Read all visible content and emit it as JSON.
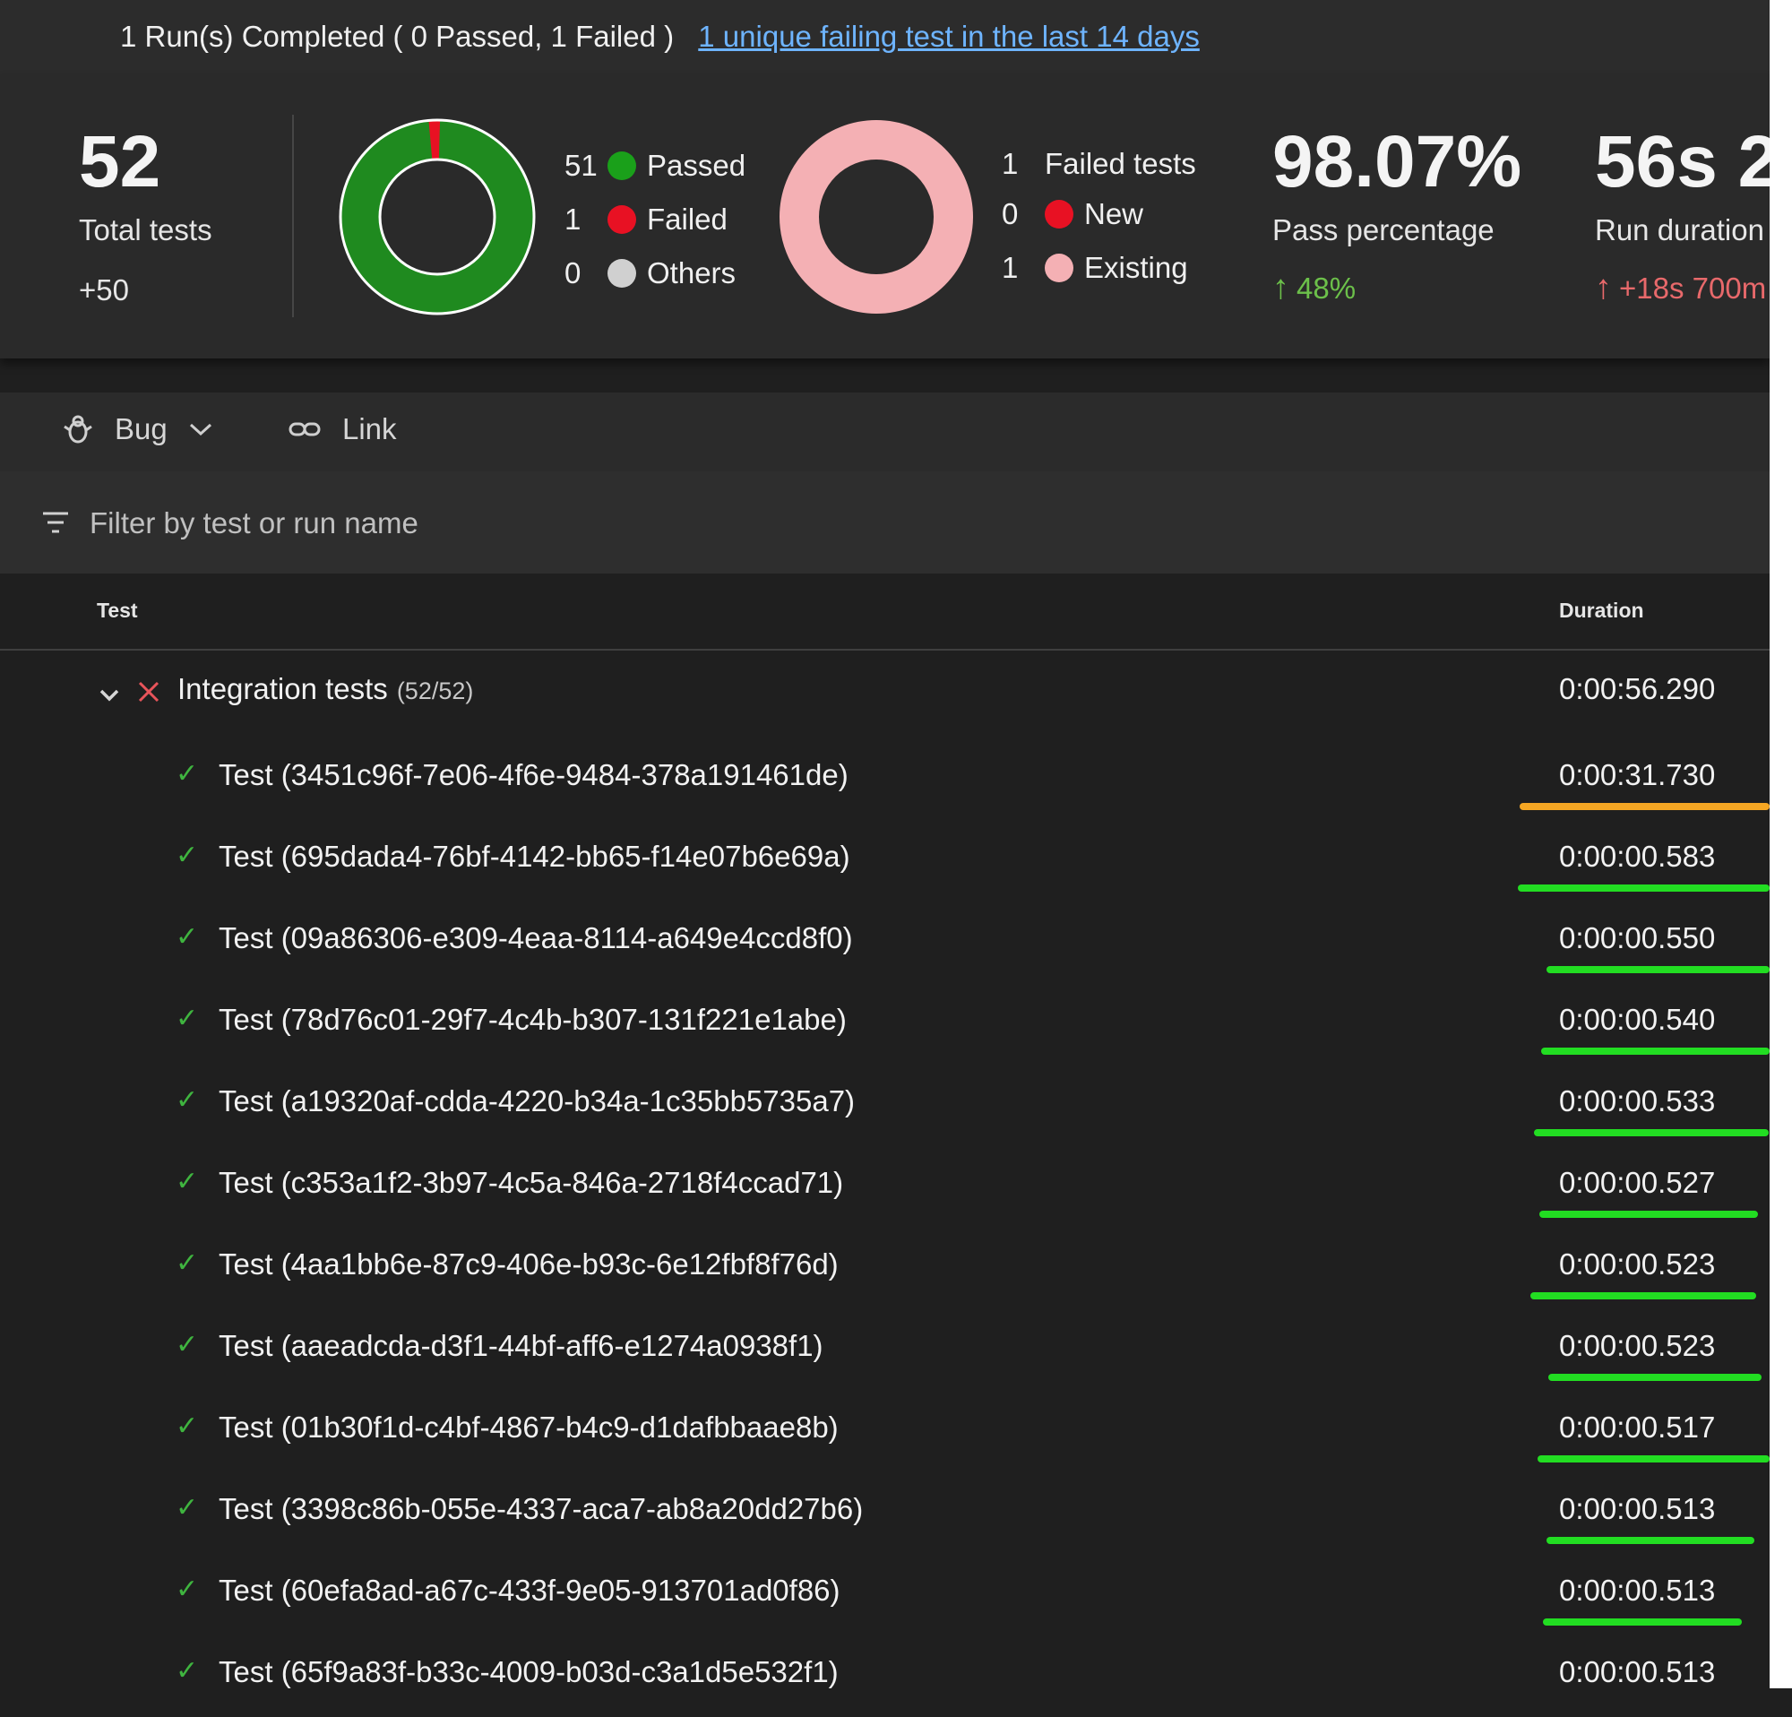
{
  "header": {
    "summary": "1 Run(s) Completed ( 0 Passed, 1 Failed )",
    "link": "1 unique failing test in the last 14 days"
  },
  "stats": {
    "total": {
      "value": "52",
      "label": "Total tests",
      "delta": "+50"
    },
    "outcome": [
      {
        "count": "51",
        "label": "Passed",
        "color": "#1aa01a"
      },
      {
        "count": "1",
        "label": "Failed",
        "color": "#e81123"
      },
      {
        "count": "0",
        "label": "Others",
        "color": "#d0d0d0"
      }
    ],
    "failed": [
      {
        "count": "1",
        "label": "Failed tests"
      },
      {
        "count": "0",
        "label": "New",
        "color": "#e81123"
      },
      {
        "count": "1",
        "label": "Existing",
        "color": "#f4b0b4"
      }
    ],
    "pass": {
      "value": "98.07%",
      "label": "Pass percentage",
      "trend": "48%"
    },
    "duration": {
      "value": "56s 2",
      "label": "Run duration",
      "trend": "+18s 700m"
    }
  },
  "toolbar": {
    "bug": "Bug",
    "link": "Link"
  },
  "filter": {
    "placeholder": "Filter by test or run name"
  },
  "table": {
    "col_test": "Test",
    "col_duration": "Duration",
    "group": {
      "name": "Integration tests",
      "count": "(52/52)",
      "duration": "0:00:56.290"
    },
    "rows": [
      {
        "name": "Test (3451c96f-7e06-4f6e-9484-378a191461de)",
        "duration": "0:00:31.730"
      },
      {
        "name": "Test (695dada4-76bf-4142-bb65-f14e07b6e69a)",
        "duration": "0:00:00.583"
      },
      {
        "name": "Test (09a86306-e309-4eaa-8114-a649e4ccd8f0)",
        "duration": "0:00:00.550"
      },
      {
        "name": "Test (78d76c01-29f7-4c4b-b307-131f221e1abe)",
        "duration": "0:00:00.540"
      },
      {
        "name": "Test (a19320af-cdda-4220-b34a-1c35bb5735a7)",
        "duration": "0:00:00.533"
      },
      {
        "name": "Test (c353a1f2-3b97-4c5a-846a-2718f4ccad71)",
        "duration": "0:00:00.527"
      },
      {
        "name": "Test (4aa1bb6e-87c9-406e-b93c-6e12fbf8f76d)",
        "duration": "0:00:00.523"
      },
      {
        "name": "Test (aaeadcda-d3f1-44bf-aff6-e1274a0938f1)",
        "duration": "0:00:00.523"
      },
      {
        "name": "Test (01b30f1d-c4bf-4867-b4c9-d1dafbbaae8b)",
        "duration": "0:00:00.517"
      },
      {
        "name": "Test (3398c86b-055e-4337-aca7-ab8a20dd27b6)",
        "duration": "0:00:00.513"
      },
      {
        "name": "Test (60efa8ad-a67c-433f-9e05-913701ad0f86)",
        "duration": "0:00:00.513"
      },
      {
        "name": "Test (65f9a83f-b33c-4009-b03d-c3a1d5e532f1)",
        "duration": "0:00:00.513"
      }
    ]
  },
  "colors": {
    "highlight_orange": "#f5a623",
    "highlight_green": "#22dd22"
  }
}
